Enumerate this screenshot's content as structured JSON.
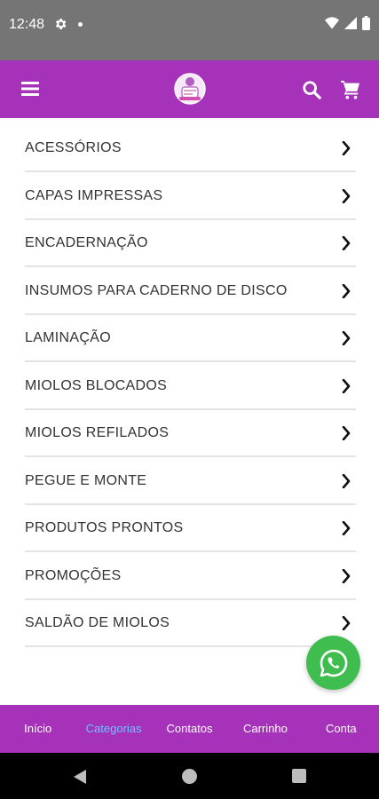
{
  "status_bar": {
    "time": "12:48"
  },
  "categories": [
    {
      "label": "ACESSÓRIOS"
    },
    {
      "label": "CAPAS IMPRESSAS"
    },
    {
      "label": "ENCADERNAÇÃO"
    },
    {
      "label": "INSUMOS PARA CADERNO DE DISCO"
    },
    {
      "label": "LAMINAÇÃO"
    },
    {
      "label": "MIOLOS BLOCADOS"
    },
    {
      "label": "MIOLOS REFILADOS"
    },
    {
      "label": "PEGUE E MONTE"
    },
    {
      "label": "PRODUTOS PRONTOS"
    },
    {
      "label": "PROMOÇÕES"
    },
    {
      "label": "SALDÃO DE MIOLOS"
    }
  ],
  "bottom_nav": [
    {
      "label": "Início"
    },
    {
      "label": "Categorias"
    },
    {
      "label": "Contatos"
    },
    {
      "label": "Carrinho"
    },
    {
      "label": "Conta"
    }
  ],
  "bottom_nav_active": "Categorias",
  "colors": {
    "brand_purple": "#a532b8",
    "active_nav": "#6ec1ff",
    "whatsapp_green": "#3fbd4e",
    "status_bar": "#757575"
  },
  "icons": {
    "menu": "menu-icon",
    "search": "search-icon",
    "cart": "cart-icon",
    "chevron": "chevron-right-icon",
    "whatsapp": "whatsapp-icon"
  }
}
